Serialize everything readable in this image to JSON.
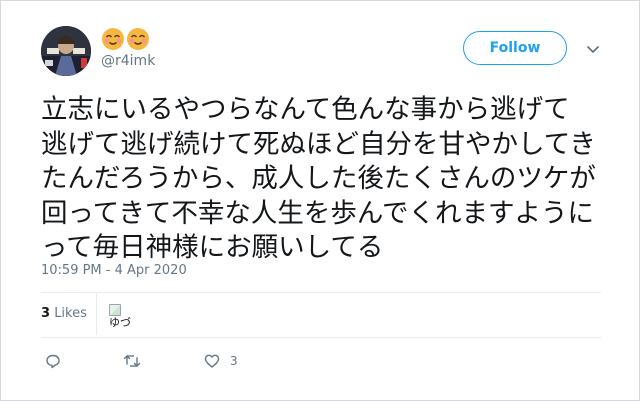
{
  "user": {
    "handle": "@r4imk",
    "display_name_emoji": [
      "smiling-face-icon",
      "smiling-face-icon"
    ]
  },
  "follow_button": {
    "label": "Follow"
  },
  "tweet": {
    "lines": [
      "立志にいるやつらなんて色んな事から逃げて",
      "逃げて逃げ続けて死ぬほど自分を甘やかしてき",
      "たんだろうから、成人した後たくさんのツケが",
      "回ってきて不幸な人生を歩んでくれますように",
      "って毎日神様にお願いしてる"
    ],
    "timestamp": "10:59 PM - 4 Apr 2020"
  },
  "stats": {
    "likes_count": "3",
    "likes_label": "Likes",
    "liker_alt": "ゆづ"
  },
  "actions": {
    "reply_count": "",
    "retweet_count": "",
    "like_count": "3"
  },
  "colors": {
    "accent": "#1da1f2",
    "muted": "#657786",
    "text": "#14171a"
  }
}
